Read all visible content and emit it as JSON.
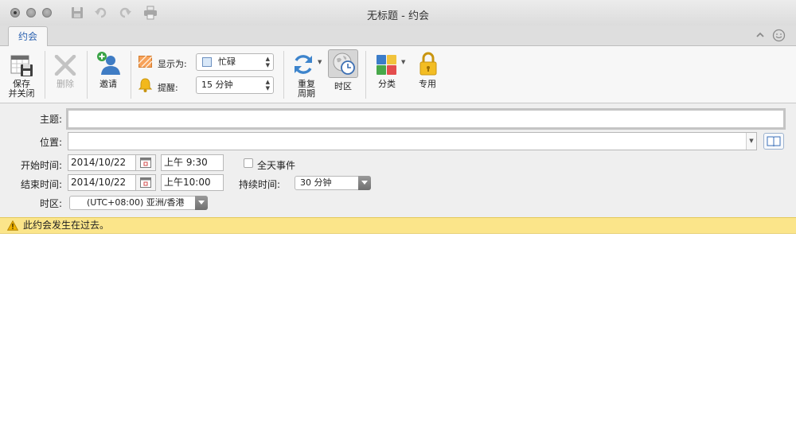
{
  "window": {
    "title": "无标题 - 约会"
  },
  "tabs": [
    {
      "label": "约会",
      "active": true
    }
  ],
  "ribbon": {
    "save_close_line1": "保存",
    "save_close_line2": "并关闭",
    "delete": "删除",
    "invite": "邀请",
    "show_as_label": "显示为:",
    "show_as_value": "忙碌",
    "reminder_label": "提醒:",
    "reminder_value": "15 分钟",
    "recurrence_line1": "重复",
    "recurrence_line2": "周期",
    "timezone": "时区",
    "categorize": "分类",
    "private": "专用"
  },
  "form": {
    "subject_label": "主题:",
    "subject_value": "",
    "location_label": "位置:",
    "location_value": "",
    "start_label": "开始时间:",
    "start_date": "2014/10/22",
    "start_time": "上午  9:30",
    "all_day_label": "全天事件",
    "all_day_checked": false,
    "end_label": "结束时间:",
    "end_date": "2014/10/22",
    "end_time": "上午10:00",
    "duration_label": "持续时间:",
    "duration_value": "30 分钟",
    "timezone_label": "时区:",
    "timezone_value": "(UTC+08:00) 亚洲/香港"
  },
  "infobar": {
    "message": "此约会发生在过去。"
  },
  "colors": {
    "accent": "#2c62b0",
    "infobar": "#fbe58a"
  }
}
